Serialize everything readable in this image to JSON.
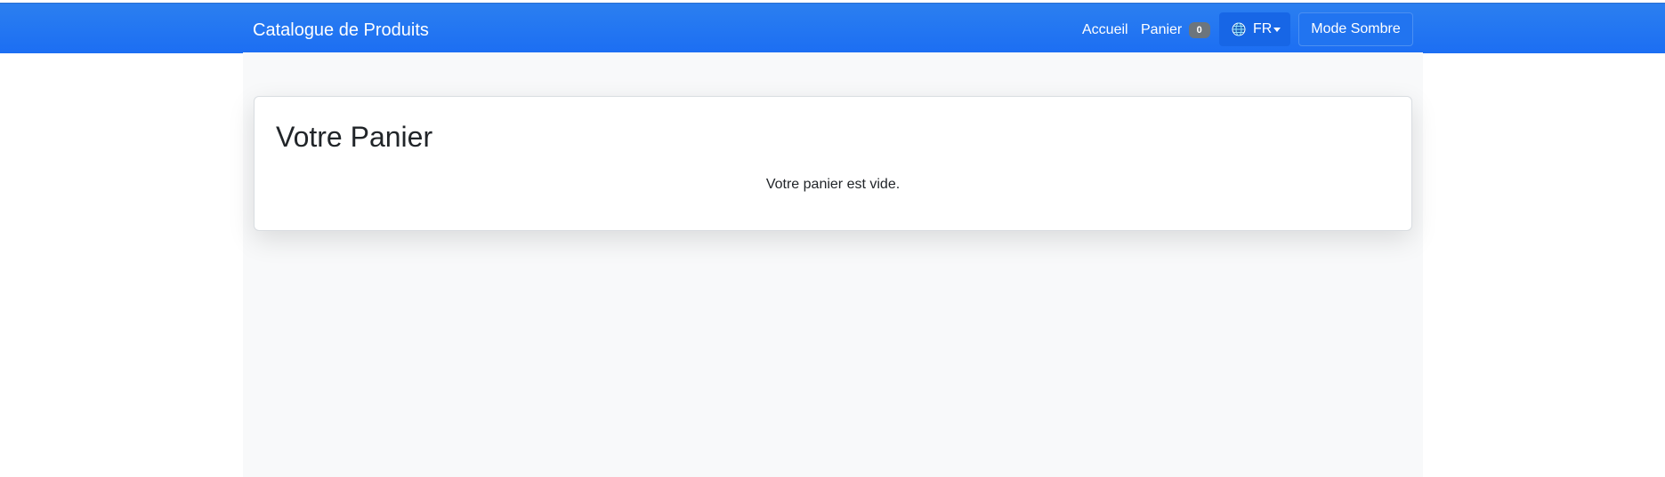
{
  "navbar": {
    "brand": "Catalogue de Produits",
    "links": {
      "home": "Accueil",
      "cart": "Panier",
      "cart_count": "0"
    },
    "language": {
      "selected": "FR",
      "icon": "globe-icon"
    },
    "dark_mode_label": "Mode Sombre"
  },
  "cart_page": {
    "title": "Votre Panier",
    "empty_message": "Votre panier est vide."
  },
  "colors": {
    "navbar": "#1c6ef3",
    "content_background": "#f8f9fa",
    "badge": "#6c757d"
  }
}
